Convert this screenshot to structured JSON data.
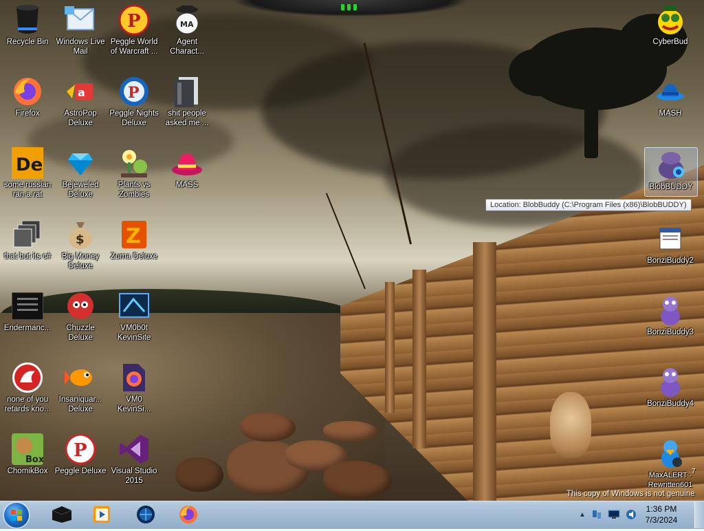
{
  "desktop": {
    "icons": [
      {
        "label": "Recycle Bin",
        "icon": "recycle-bin-icon",
        "name": "icon-recycle-bin"
      },
      {
        "label": "Windows Live\nMail",
        "icon": "mail-icon",
        "name": "icon-windows-live-mail"
      },
      {
        "label": "Peggle World\nof Warcraft ...",
        "icon": "peggle-icon",
        "name": "icon-peggle-wow"
      },
      {
        "label": "Agent\nCharact...",
        "icon": "agent-character-icon",
        "name": "icon-agent-character"
      },
      {
        "label": "Firefox",
        "icon": "firefox-icon",
        "name": "icon-firefox"
      },
      {
        "label": "AstroPop\nDeluxe",
        "icon": "astropop-icon",
        "name": "icon-astropop"
      },
      {
        "label": "Peggle Nights\nDeluxe",
        "icon": "peggle-nights-icon",
        "name": "icon-peggle-nights"
      },
      {
        "label": "shit people\nasked me ...",
        "icon": "folder-icon",
        "name": "icon-folder-people"
      },
      {
        "label": "some russian\nran a rat",
        "icon": "de-icon",
        "name": "icon-russian-rat"
      },
      {
        "label": "Bejeweled\nDeluxe",
        "icon": "gem-icon",
        "name": "icon-bejeweled"
      },
      {
        "label": "Plants vs\nZombies",
        "icon": "plants-icon",
        "name": "icon-plants-vs-zombies"
      },
      {
        "label": "MASS",
        "icon": "hat-icon",
        "name": "icon-mass"
      },
      {
        "label": "that but its c#",
        "icon": "windows-stack-icon",
        "name": "icon-that-but-csharp"
      },
      {
        "label": "Big Money\nDeluxe",
        "icon": "money-bag-icon",
        "name": "icon-big-money"
      },
      {
        "label": "Zuma Deluxe",
        "icon": "zuma-icon",
        "name": "icon-zuma"
      },
      {
        "label": "Endermanc...",
        "icon": "terminal-icon",
        "name": "icon-endermanch"
      },
      {
        "label": "Chuzzle\nDeluxe",
        "icon": "chuzzle-icon",
        "name": "icon-chuzzle"
      },
      {
        "label": "VM0b0t\nKevinSite",
        "icon": "vm-icon",
        "name": "icon-vm0b0t"
      },
      {
        "label": "none of you\nretards kno...",
        "icon": "dragon-icon",
        "name": "icon-none-of-you"
      },
      {
        "label": "Insaniquar...\nDeluxe",
        "icon": "fish-icon",
        "name": "icon-insaniquarium"
      },
      {
        "label": "VM0\nKevinSi...",
        "icon": "firefox-file-icon",
        "name": "icon-vm0-kevinsite"
      },
      {
        "label": "ChomikBox",
        "icon": "chomikbox-icon",
        "name": "icon-chomikbox"
      },
      {
        "label": "Peggle Deluxe",
        "icon": "peggle-icon",
        "name": "icon-peggle-deluxe"
      },
      {
        "label": "Visual Studio\n2015",
        "icon": "visual-studio-icon",
        "name": "icon-visual-studio"
      },
      {
        "label": "CyberBud",
        "icon": "cyberbud-icon",
        "name": "icon-cyberbud"
      },
      {
        "label": "MASH",
        "icon": "mash-hat-icon",
        "name": "icon-mash"
      },
      {
        "label": "BlobBUDDY",
        "icon": "blobbuddy-icon",
        "name": "icon-blobbuddy"
      },
      {
        "label": "BonziBuddy2",
        "icon": "window-icon",
        "name": "icon-bonzibuddy2"
      },
      {
        "label": "BonziBuddy3",
        "icon": "bonzi-icon",
        "name": "icon-bonzibuddy3"
      },
      {
        "label": "BonziBuddy4",
        "icon": "bonzi-icon",
        "name": "icon-bonzibuddy4"
      },
      {
        "label": "MaxALERT -\nRewritten601",
        "icon": "maxalert-icon",
        "name": "icon-maxalert"
      }
    ],
    "tooltip": "Location: BlobBuddy (C:\\Program Files (x86)\\BlobBUDDY)",
    "watermark": "This copy of Windows is not genuine",
    "corner_note": "7"
  },
  "taskbar": {
    "pinned": [
      {
        "icon": "start-orb-icon",
        "name": "start-button"
      },
      {
        "icon": "black-box-icon",
        "name": "taskbar-app-1"
      },
      {
        "icon": "media-player-icon",
        "name": "taskbar-media-player"
      },
      {
        "icon": "globe-icon",
        "name": "taskbar-globe-app"
      },
      {
        "icon": "firefox-icon",
        "name": "taskbar-firefox"
      }
    ],
    "tray_icons": [
      "show-hidden-icons",
      "network-icon",
      "monitor-icon",
      "volume-icon"
    ],
    "clock": {
      "time": "1:36 PM",
      "date": "7/3/2024"
    }
  },
  "colors": {
    "taskbar": "#a4bcd4",
    "label_text": "#ffffff",
    "tooltip_border": "#767676"
  }
}
